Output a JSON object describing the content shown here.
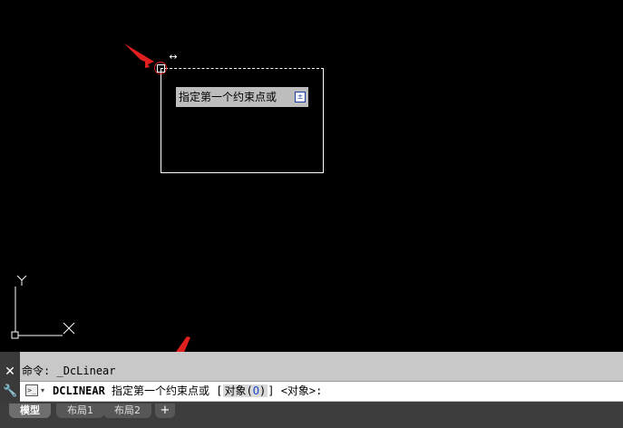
{
  "drawing": {
    "tooltip_text": "指定第一个约束点或",
    "tooltip_button_glyph": "±"
  },
  "ucs": {
    "y_label": "Y",
    "x_label": "X"
  },
  "command": {
    "history_label": "命令:",
    "history_value": "_DcLinear",
    "current_command": "DCLINEAR",
    "prompt_text": "指定第一个约束点或",
    "bracket_open": "[",
    "option_label": "对象(",
    "option_key": "O",
    "option_close": ")",
    "bracket_close": "]",
    "default_option": "<对象>:"
  },
  "tabs": [
    {
      "label": "模型",
      "active": true
    },
    {
      "label": "布局1",
      "active": false
    },
    {
      "label": "布局2",
      "active": false
    }
  ],
  "colors": {
    "annotation_arrow": "#e02020",
    "canvas_bg": "#000000"
  }
}
